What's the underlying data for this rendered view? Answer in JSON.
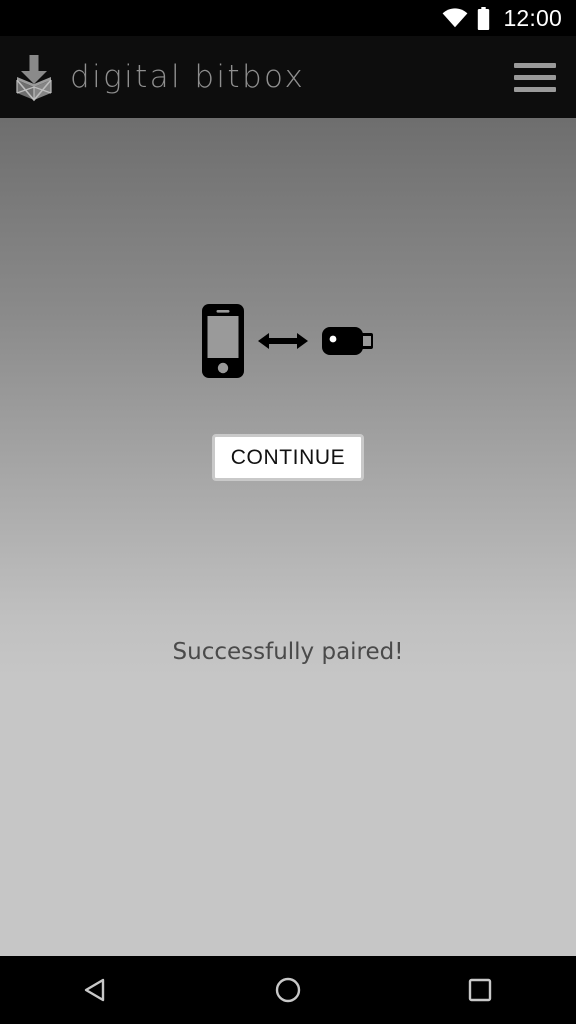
{
  "status_bar": {
    "clock": "12:00",
    "wifi_icon": "wifi-icon",
    "battery_icon": "battery-full-icon",
    "icon_color": "#ffffff",
    "background": "#000000"
  },
  "toolbar": {
    "logo_icon": "digital-bitbox-logo-icon",
    "title": "digital bitbox",
    "title_color": "#8f8f8f",
    "menu_icon": "hamburger-menu-icon",
    "background": "#0d0d0d"
  },
  "main": {
    "illustration": {
      "phone_icon": "smartphone-icon",
      "arrow_icon": "double-arrow-icon",
      "device_icon": "usb-hardware-wallet-icon",
      "icon_color": "#000000"
    },
    "continue_button": {
      "label": "CONTINUE",
      "text_color": "#111111",
      "background": "#ffffff",
      "border_color": "#c9c9c9"
    },
    "status_message": "Successfully paired!",
    "status_message_color": "#4a4a4a",
    "background_top": "#6e6e6e",
    "background_bottom": "#c6c6c6"
  },
  "nav_bar": {
    "background": "#000000",
    "icon_color": "#c8c8c8",
    "buttons": [
      {
        "name": "back-button",
        "icon": "back-triangle-icon"
      },
      {
        "name": "home-button",
        "icon": "home-circle-icon"
      },
      {
        "name": "recents-button",
        "icon": "recents-square-icon"
      }
    ]
  }
}
